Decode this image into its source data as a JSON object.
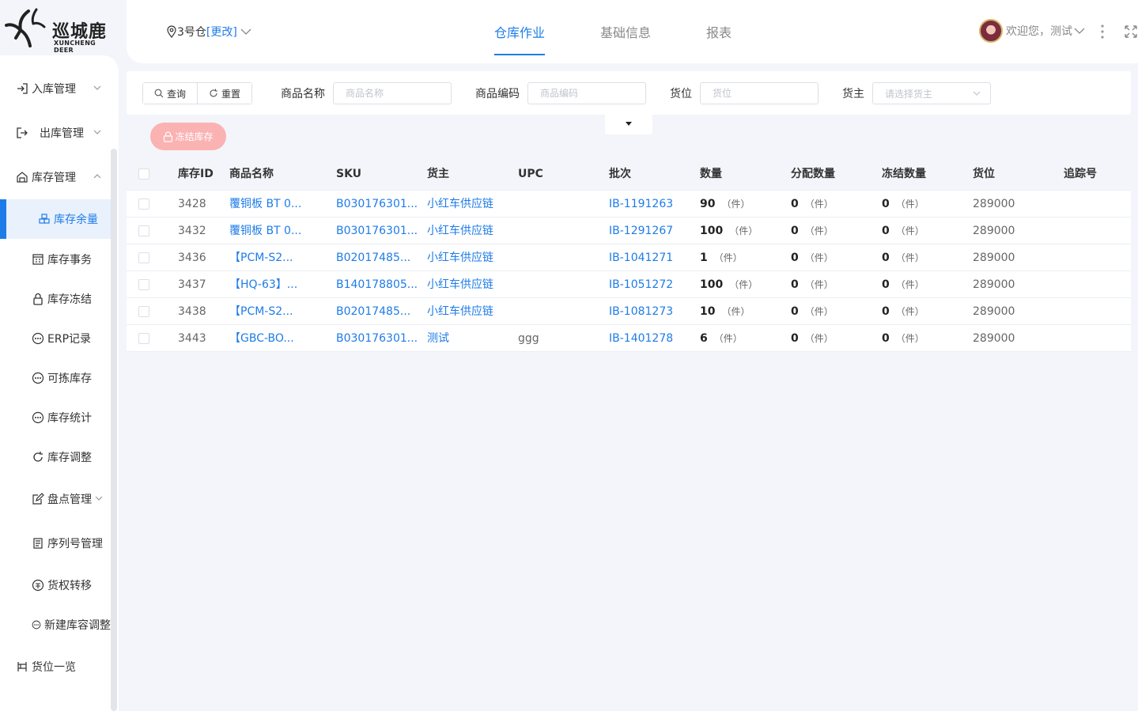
{
  "brand": {
    "name_cn": "巡城鹿",
    "name_en": "XUNCHENG DEER"
  },
  "header": {
    "warehouse": "3号仓",
    "change_label": "[更改]",
    "tabs": [
      {
        "label": "仓库作业",
        "active": true
      },
      {
        "label": "基础信息",
        "active": false
      },
      {
        "label": "报表",
        "active": false
      }
    ],
    "user_greeting": "欢迎您，测试"
  },
  "sidebar": {
    "items": [
      {
        "label": "入库管理",
        "icon": "inbound-icon",
        "level": "top",
        "expandable": true
      },
      {
        "label": "出库管理",
        "icon": "outbound-icon",
        "level": "top",
        "expandable": true
      },
      {
        "label": "库存管理",
        "icon": "warehouse-icon",
        "level": "top",
        "expandable": true,
        "expanded": true
      },
      {
        "label": "库存余量",
        "icon": "boxes-icon",
        "level": "sub",
        "active": true
      },
      {
        "label": "库存事务",
        "icon": "calendar-icon",
        "level": "sub"
      },
      {
        "label": "库存冻结",
        "icon": "lock-icon",
        "level": "sub"
      },
      {
        "label": "ERP记录",
        "icon": "dots-circle-icon",
        "level": "sub"
      },
      {
        "label": "可拣库存",
        "icon": "dots-circle-icon",
        "level": "sub"
      },
      {
        "label": "库存统计",
        "icon": "dots-circle-icon",
        "level": "sub"
      },
      {
        "label": "库存调整",
        "icon": "refresh-icon",
        "level": "sub"
      },
      {
        "label": "盘点管理",
        "icon": "edit-icon",
        "level": "sub",
        "expandable": true
      },
      {
        "label": "序列号管理",
        "icon": "document-icon",
        "level": "sub"
      },
      {
        "label": "货权转移",
        "icon": "ownership-icon",
        "level": "sub"
      },
      {
        "label": "新建库容调整",
        "icon": "dots-circle-icon",
        "level": "sub"
      },
      {
        "label": "货位一览",
        "icon": "shelf-icon",
        "level": "top"
      }
    ]
  },
  "filter": {
    "query_label": "查询",
    "reset_label": "重置",
    "product_name_label": "商品名称",
    "product_name_placeholder": "商品名称",
    "product_code_label": "商品编码",
    "product_code_placeholder": "商品编码",
    "location_label": "货位",
    "location_placeholder": "货位",
    "owner_label": "货主",
    "owner_placeholder": "请选择货主"
  },
  "actions": {
    "freeze_label": "冻结库存"
  },
  "table": {
    "columns": [
      "库存ID",
      "商品名称",
      "SKU",
      "货主",
      "UPC",
      "批次",
      "数量",
      "分配数量",
      "冻结数量",
      "货位",
      "追踪号"
    ],
    "unit": "（件）",
    "rows": [
      {
        "id": "3428",
        "name": "覆铜板 BT 0...",
        "sku": "B030176301...",
        "owner": "小红车供应链",
        "upc": "",
        "batch": "IB-1191263",
        "qty": "90",
        "alloc": "0",
        "frozen": "0",
        "location": "289000",
        "track": ""
      },
      {
        "id": "3432",
        "name": "覆铜板 BT 0...",
        "sku": "B030176301...",
        "owner": "小红车供应链",
        "upc": "",
        "batch": "IB-1291267",
        "qty": "100",
        "alloc": "0",
        "frozen": "0",
        "location": "289000",
        "track": ""
      },
      {
        "id": "3436",
        "name": "【PCM-S2...",
        "sku": "B02017485...",
        "owner": "小红车供应链",
        "upc": "",
        "batch": "IB-1041271",
        "qty": "1",
        "alloc": "0",
        "frozen": "0",
        "location": "289000",
        "track": ""
      },
      {
        "id": "3437",
        "name": "【HQ-63】...",
        "sku": "B140178805...",
        "owner": "小红车供应链",
        "upc": "",
        "batch": "IB-1051272",
        "qty": "100",
        "alloc": "0",
        "frozen": "0",
        "location": "289000",
        "track": ""
      },
      {
        "id": "3438",
        "name": "【PCM-S2...",
        "sku": "B02017485...",
        "owner": "小红车供应链",
        "upc": "",
        "batch": "IB-1081273",
        "qty": "10",
        "alloc": "0",
        "frozen": "0",
        "location": "289000",
        "track": ""
      },
      {
        "id": "3443",
        "name": "【GBC-BO...",
        "sku": "B030176301...",
        "owner": "测试",
        "upc": "ggg",
        "batch": "IB-1401278",
        "qty": "6",
        "alloc": "0",
        "frozen": "0",
        "location": "289000",
        "track": ""
      }
    ]
  },
  "colors": {
    "accent": "#1e7ce8",
    "freeze_button": "#fbb2b2",
    "background": "#f3f5fa"
  }
}
